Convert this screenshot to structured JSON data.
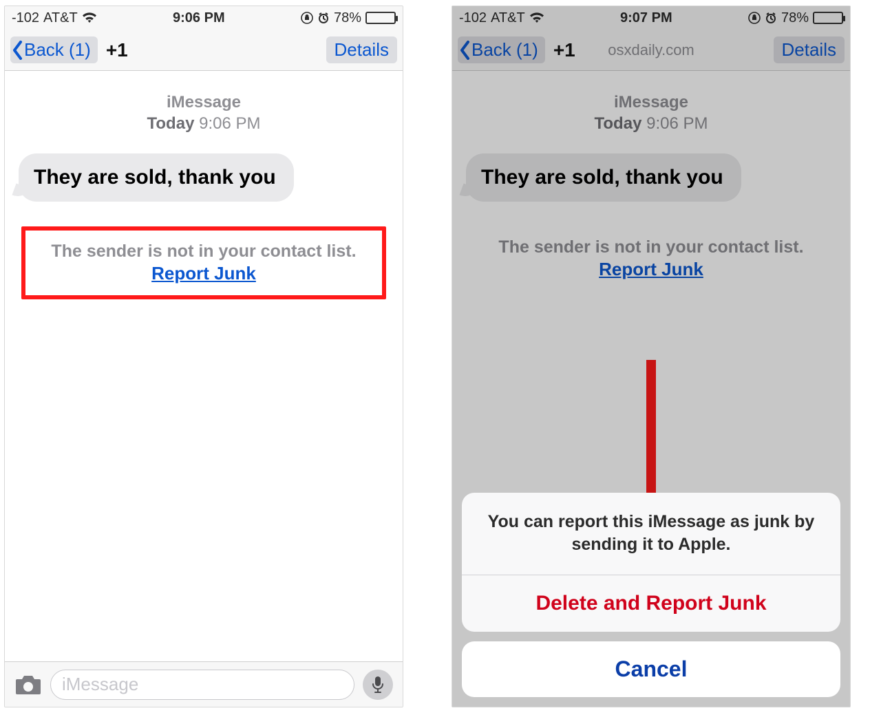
{
  "left": {
    "status": {
      "signal": "-102",
      "carrier": "AT&T",
      "time": "9:06 PM",
      "battery_pct": "78%"
    },
    "nav": {
      "back_label": "Back (1)",
      "title": "+1",
      "details_label": "Details"
    },
    "thread": {
      "service": "iMessage",
      "day": "Today",
      "time": "9:06 PM",
      "bubble": "They are sold, thank you",
      "notice": "The sender is not in your contact list.",
      "report_link": "Report Junk"
    },
    "input": {
      "placeholder": "iMessage"
    }
  },
  "right": {
    "status": {
      "signal": "-102",
      "carrier": "AT&T",
      "time": "9:07 PM",
      "battery_pct": "78%"
    },
    "nav": {
      "back_label": "Back (1)",
      "title": "+1",
      "subtitle": "osxdaily.com",
      "details_label": "Details"
    },
    "thread": {
      "service": "iMessage",
      "day": "Today",
      "time": "9:06 PM",
      "bubble": "They are sold, thank you",
      "notice": "The sender is not in your contact list.",
      "report_link": "Report Junk"
    },
    "sheet": {
      "message": "You can report this iMessage as junk by sending it to Apple.",
      "destructive": "Delete and Report Junk",
      "cancel": "Cancel"
    }
  }
}
